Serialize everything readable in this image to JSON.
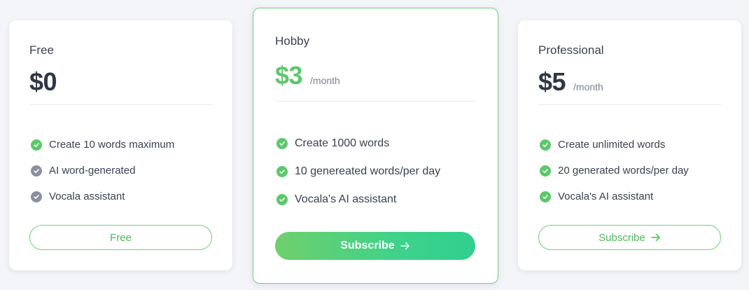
{
  "plans": [
    {
      "name": "Free",
      "price": "$0",
      "period": "",
      "features": [
        {
          "text": "Create 10 words maximum",
          "included": true
        },
        {
          "text": "AI word-generated",
          "included": false
        },
        {
          "text": "Vocala assistant",
          "included": false
        }
      ],
      "button_label": "Free"
    },
    {
      "name": "Hobby",
      "price": "$3",
      "period": "/month",
      "features": [
        {
          "text": "Create 1000 words",
          "included": true
        },
        {
          "text": "10 genereated words/per day",
          "included": true
        },
        {
          "text": "Vocala's AI assistant",
          "included": true
        }
      ],
      "button_label": "Subscribe"
    },
    {
      "name": "Professional",
      "price": "$5",
      "period": "/month",
      "features": [
        {
          "text": "Create unlimited words",
          "included": true
        },
        {
          "text": "20 generated words/per day",
          "included": true
        },
        {
          "text": "Vocala's AI assistant",
          "included": true
        }
      ],
      "button_label": "Subscribe"
    }
  ],
  "colors": {
    "accent": "#5cc86a",
    "disabled_check": "#8a909c",
    "text": "#2f3746",
    "background": "#f4f5f9"
  },
  "icons": {
    "included": "check-circle-icon",
    "excluded": "check-circle-gray-icon",
    "button_arrow": "arrow-right-icon"
  }
}
